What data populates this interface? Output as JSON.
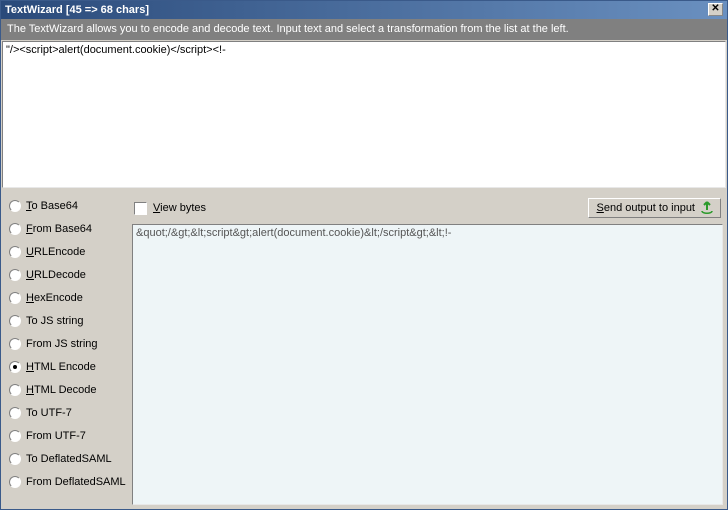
{
  "title": "TextWizard [45 => 68 chars]",
  "info": "The TextWizard allows you to encode and decode text. Input text and select a transformation from the list at the left.",
  "inputText": "\"/><script>alert(document.cookie)</script><!-",
  "transforms": [
    {
      "label": "To Base64",
      "accel": "T",
      "checked": false
    },
    {
      "label": "From Base64",
      "accel": "F",
      "checked": false
    },
    {
      "label": "URLEncode",
      "accel": "U",
      "checked": false
    },
    {
      "label": "URLDecode",
      "accel": "U",
      "checked": false
    },
    {
      "label": "HexEncode",
      "accel": "H",
      "checked": false
    },
    {
      "label": "To JS string",
      "accel": "",
      "checked": false
    },
    {
      "label": "From JS string",
      "accel": "",
      "checked": false
    },
    {
      "label": "HTML Encode",
      "accel": "H",
      "checked": true
    },
    {
      "label": "HTML Decode",
      "accel": "H",
      "checked": false
    },
    {
      "label": "To UTF-7",
      "accel": "",
      "checked": false
    },
    {
      "label": "From UTF-7",
      "accel": "",
      "checked": false
    },
    {
      "label": "To DeflatedSAML",
      "accel": "",
      "checked": false
    },
    {
      "label": "From DeflatedSAML",
      "accel": "",
      "checked": false
    }
  ],
  "viewBytes": {
    "label": "View bytes",
    "accel": "V",
    "checked": false
  },
  "sendBtn": {
    "label": "Send output to input",
    "accel": "S"
  },
  "outputText": "&quot;/&gt;&lt;script&gt;alert(document.cookie)&lt;/script&gt;&lt;!-"
}
